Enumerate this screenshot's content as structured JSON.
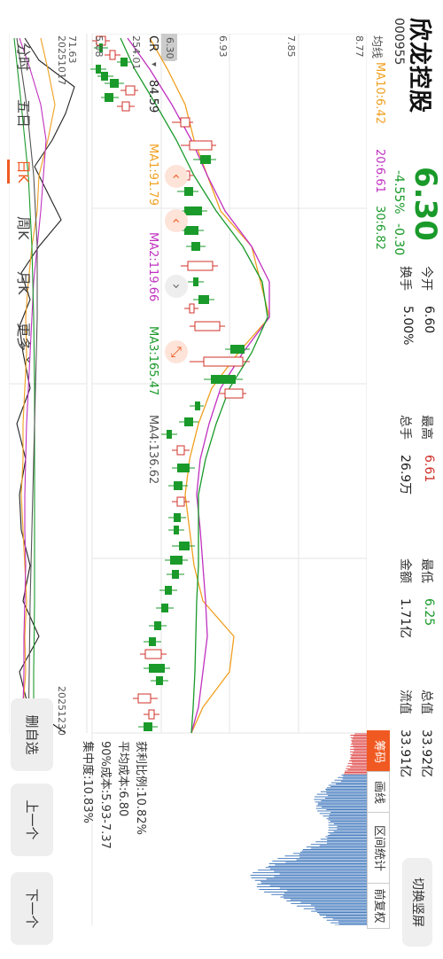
{
  "header": {
    "name": "欣龙控股",
    "code": "000955",
    "price": "6.30",
    "change_pct": "-4.55%",
    "change_amt": "-0.30"
  },
  "stats": [
    {
      "label": "今开",
      "value": "6.60",
      "color": "#222222"
    },
    {
      "label": "最高",
      "value": "6.61",
      "color": "#d0302a"
    },
    {
      "label": "最低",
      "value": "6.25",
      "color": "#1a9a2a"
    },
    {
      "label": "总值",
      "value": "33.92亿",
      "color": "#222222"
    },
    {
      "label": "换手",
      "value": "5.00%",
      "color": "#222222"
    },
    {
      "label": "总手",
      "value": "26.9万",
      "color": "#222222"
    },
    {
      "label": "金额",
      "value": "1.71亿",
      "color": "#222222"
    },
    {
      "label": "流值",
      "value": "33.91亿",
      "color": "#222222"
    }
  ],
  "switch_label": "切换竖屏",
  "ma_legend": {
    "label": "均线",
    "ma10": "MA10:6.42",
    "ma20": "20:6.61",
    "ma30": "30:6.82"
  },
  "chip_tabs": [
    {
      "label": "筹码",
      "active": true
    },
    {
      "label": "画线",
      "active": false
    },
    {
      "label": "区间统计",
      "active": false
    },
    {
      "label": "前复权",
      "active": false
    }
  ],
  "price_axis": [
    "8.77",
    "7.85",
    "6.93",
    "6.30",
    "5.08"
  ],
  "cr_legend": {
    "label": "CR",
    "value": "84.59",
    "ma1": "MA1:91.79",
    "ma2": "MA2:119.66",
    "ma3": "MA3:165.47",
    "ma4": "MA4:136.62"
  },
  "cr_axis": [
    "254.01",
    "71.63"
  ],
  "dates": [
    "20251017",
    "20251230"
  ],
  "chip_stats": {
    "profit_ratio": "获利比例:10.82%",
    "avg_cost": "平均成本:6.80",
    "cost90": "90%成本:5.93-7.37",
    "concentration": "集中度:10.83%"
  },
  "periods": [
    {
      "label": "分时",
      "active": false
    },
    {
      "label": "五日",
      "active": false
    },
    {
      "label": "日K",
      "active": true
    },
    {
      "label": "周K",
      "active": false
    },
    {
      "label": "月K",
      "active": false
    },
    {
      "label": "更多",
      "active": false
    }
  ],
  "side_buttons": [
    "删自选",
    "上一个",
    "下一个"
  ],
  "colors": {
    "up": "#d0302a",
    "down": "#1a9a2a",
    "accent": "#f05a22",
    "ma10": "#f0a020",
    "ma20": "#c030c0",
    "ma30": "#1a9a2a"
  }
}
